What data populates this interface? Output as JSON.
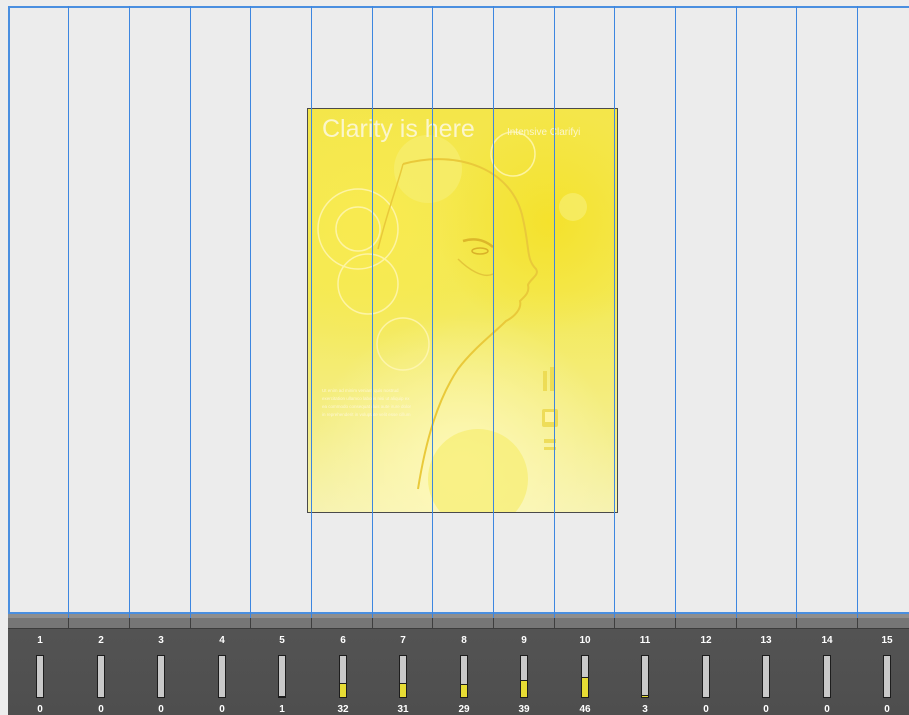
{
  "canvas": {
    "accent_color": "#3d86e0",
    "background_color": "#ececec"
  },
  "poster": {
    "headline": "Clarity is here",
    "subheadline": "Intensive Clarifyi",
    "body_text": "Ut enim ad minim veniam quis nostrud exercitation ullamco laboris nisi ut aliquip ex ea commodo consequat duis aute irure dolor in reprehenderit in voluptate velit esse cillum",
    "primary_color": "#f3e955"
  },
  "timeline": {
    "tracks": [
      {
        "label": "1",
        "count": "0",
        "level": 0
      },
      {
        "label": "2",
        "count": "0",
        "level": 0
      },
      {
        "label": "3",
        "count": "0",
        "level": 0
      },
      {
        "label": "4",
        "count": "0",
        "level": 0
      },
      {
        "label": "5",
        "count": "1",
        "level": 0.02
      },
      {
        "label": "6",
        "count": "32",
        "level": 0.35
      },
      {
        "label": "7",
        "count": "31",
        "level": 0.34
      },
      {
        "label": "8",
        "count": "29",
        "level": 0.32
      },
      {
        "label": "9",
        "count": "39",
        "level": 0.42
      },
      {
        "label": "10",
        "count": "46",
        "level": 0.5
      },
      {
        "label": "11",
        "count": "3",
        "level": 0.04
      },
      {
        "label": "12",
        "count": "0",
        "level": 0
      },
      {
        "label": "13",
        "count": "0",
        "level": 0
      },
      {
        "label": "14",
        "count": "0",
        "level": 0
      },
      {
        "label": "15",
        "count": "0",
        "level": 0
      }
    ],
    "meter_color": "#e7dc34"
  }
}
